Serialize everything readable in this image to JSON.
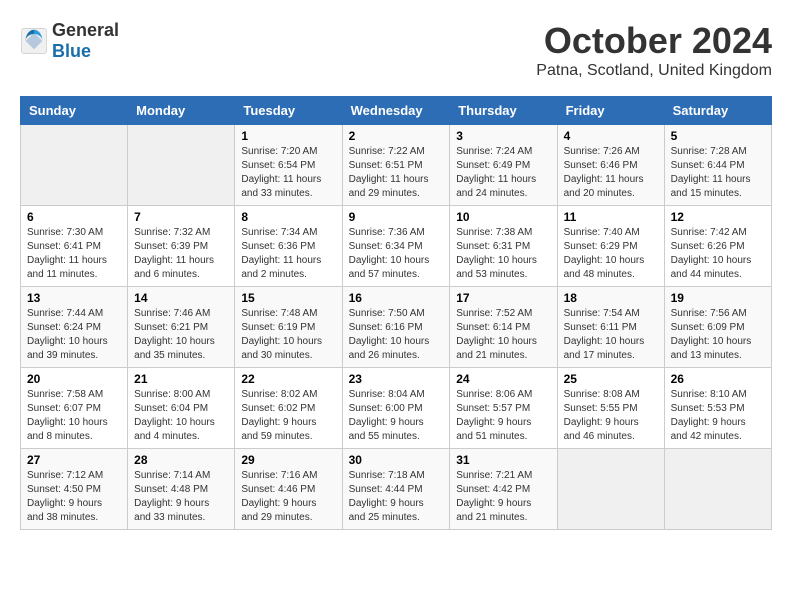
{
  "logo": {
    "text_general": "General",
    "text_blue": "Blue"
  },
  "title": {
    "month": "October 2024",
    "location": "Patna, Scotland, United Kingdom"
  },
  "weekdays": [
    "Sunday",
    "Monday",
    "Tuesday",
    "Wednesday",
    "Thursday",
    "Friday",
    "Saturday"
  ],
  "weeks": [
    [
      {
        "day": "",
        "info": ""
      },
      {
        "day": "",
        "info": ""
      },
      {
        "day": "1",
        "info": "Sunrise: 7:20 AM\nSunset: 6:54 PM\nDaylight: 11 hours\nand 33 minutes."
      },
      {
        "day": "2",
        "info": "Sunrise: 7:22 AM\nSunset: 6:51 PM\nDaylight: 11 hours\nand 29 minutes."
      },
      {
        "day": "3",
        "info": "Sunrise: 7:24 AM\nSunset: 6:49 PM\nDaylight: 11 hours\nand 24 minutes."
      },
      {
        "day": "4",
        "info": "Sunrise: 7:26 AM\nSunset: 6:46 PM\nDaylight: 11 hours\nand 20 minutes."
      },
      {
        "day": "5",
        "info": "Sunrise: 7:28 AM\nSunset: 6:44 PM\nDaylight: 11 hours\nand 15 minutes."
      }
    ],
    [
      {
        "day": "6",
        "info": "Sunrise: 7:30 AM\nSunset: 6:41 PM\nDaylight: 11 hours\nand 11 minutes."
      },
      {
        "day": "7",
        "info": "Sunrise: 7:32 AM\nSunset: 6:39 PM\nDaylight: 11 hours\nand 6 minutes."
      },
      {
        "day": "8",
        "info": "Sunrise: 7:34 AM\nSunset: 6:36 PM\nDaylight: 11 hours\nand 2 minutes."
      },
      {
        "day": "9",
        "info": "Sunrise: 7:36 AM\nSunset: 6:34 PM\nDaylight: 10 hours\nand 57 minutes."
      },
      {
        "day": "10",
        "info": "Sunrise: 7:38 AM\nSunset: 6:31 PM\nDaylight: 10 hours\nand 53 minutes."
      },
      {
        "day": "11",
        "info": "Sunrise: 7:40 AM\nSunset: 6:29 PM\nDaylight: 10 hours\nand 48 minutes."
      },
      {
        "day": "12",
        "info": "Sunrise: 7:42 AM\nSunset: 6:26 PM\nDaylight: 10 hours\nand 44 minutes."
      }
    ],
    [
      {
        "day": "13",
        "info": "Sunrise: 7:44 AM\nSunset: 6:24 PM\nDaylight: 10 hours\nand 39 minutes."
      },
      {
        "day": "14",
        "info": "Sunrise: 7:46 AM\nSunset: 6:21 PM\nDaylight: 10 hours\nand 35 minutes."
      },
      {
        "day": "15",
        "info": "Sunrise: 7:48 AM\nSunset: 6:19 PM\nDaylight: 10 hours\nand 30 minutes."
      },
      {
        "day": "16",
        "info": "Sunrise: 7:50 AM\nSunset: 6:16 PM\nDaylight: 10 hours\nand 26 minutes."
      },
      {
        "day": "17",
        "info": "Sunrise: 7:52 AM\nSunset: 6:14 PM\nDaylight: 10 hours\nand 21 minutes."
      },
      {
        "day": "18",
        "info": "Sunrise: 7:54 AM\nSunset: 6:11 PM\nDaylight: 10 hours\nand 17 minutes."
      },
      {
        "day": "19",
        "info": "Sunrise: 7:56 AM\nSunset: 6:09 PM\nDaylight: 10 hours\nand 13 minutes."
      }
    ],
    [
      {
        "day": "20",
        "info": "Sunrise: 7:58 AM\nSunset: 6:07 PM\nDaylight: 10 hours\nand 8 minutes."
      },
      {
        "day": "21",
        "info": "Sunrise: 8:00 AM\nSunset: 6:04 PM\nDaylight: 10 hours\nand 4 minutes."
      },
      {
        "day": "22",
        "info": "Sunrise: 8:02 AM\nSunset: 6:02 PM\nDaylight: 9 hours\nand 59 minutes."
      },
      {
        "day": "23",
        "info": "Sunrise: 8:04 AM\nSunset: 6:00 PM\nDaylight: 9 hours\nand 55 minutes."
      },
      {
        "day": "24",
        "info": "Sunrise: 8:06 AM\nSunset: 5:57 PM\nDaylight: 9 hours\nand 51 minutes."
      },
      {
        "day": "25",
        "info": "Sunrise: 8:08 AM\nSunset: 5:55 PM\nDaylight: 9 hours\nand 46 minutes."
      },
      {
        "day": "26",
        "info": "Sunrise: 8:10 AM\nSunset: 5:53 PM\nDaylight: 9 hours\nand 42 minutes."
      }
    ],
    [
      {
        "day": "27",
        "info": "Sunrise: 7:12 AM\nSunset: 4:50 PM\nDaylight: 9 hours\nand 38 minutes."
      },
      {
        "day": "28",
        "info": "Sunrise: 7:14 AM\nSunset: 4:48 PM\nDaylight: 9 hours\nand 33 minutes."
      },
      {
        "day": "29",
        "info": "Sunrise: 7:16 AM\nSunset: 4:46 PM\nDaylight: 9 hours\nand 29 minutes."
      },
      {
        "day": "30",
        "info": "Sunrise: 7:18 AM\nSunset: 4:44 PM\nDaylight: 9 hours\nand 25 minutes."
      },
      {
        "day": "31",
        "info": "Sunrise: 7:21 AM\nSunset: 4:42 PM\nDaylight: 9 hours\nand 21 minutes."
      },
      {
        "day": "",
        "info": ""
      },
      {
        "day": "",
        "info": ""
      }
    ]
  ]
}
